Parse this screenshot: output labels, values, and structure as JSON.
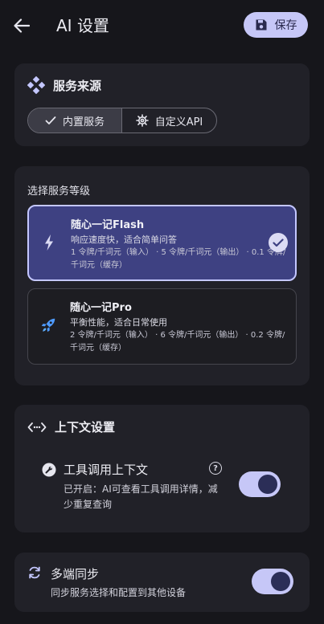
{
  "header": {
    "title": "AI 设置",
    "save_label": "保存"
  },
  "service_source": {
    "title": "服务来源",
    "options": [
      {
        "label": "内置服务",
        "selected": true
      },
      {
        "label": "自定义API",
        "selected": false
      }
    ]
  },
  "service_tier": {
    "title": "选择服务等级",
    "tiers": [
      {
        "name": "随心一记Flash",
        "desc": "响应速度快，适合简单问答",
        "price": "1 令牌/千词元（输入） · 5 令牌/千词元（输出） · 0.1 令牌/千词元（缓存）",
        "icon": "lightning-icon",
        "selected": true
      },
      {
        "name": "随心一记Pro",
        "desc": "平衡性能，适合日常使用",
        "price": "2 令牌/千词元（输入） · 6 令牌/千词元（输出） · 0.2 令牌/千词元（缓存）",
        "icon": "rocket-icon",
        "selected": false
      }
    ]
  },
  "context": {
    "title": "上下文设置",
    "tool_context": {
      "title": "工具调用上下文",
      "subtitle": "已开启：AI可查看工具调用详情，减少重复查询",
      "help": "?",
      "enabled": true
    }
  },
  "sync": {
    "title": "多端同步",
    "subtitle": "同步服务选择和配置到其他设备",
    "enabled": true
  },
  "colors": {
    "background": "#16161b",
    "card": "#212128",
    "accent": "#c6c7f7",
    "selected_tier": "#3e4182"
  }
}
